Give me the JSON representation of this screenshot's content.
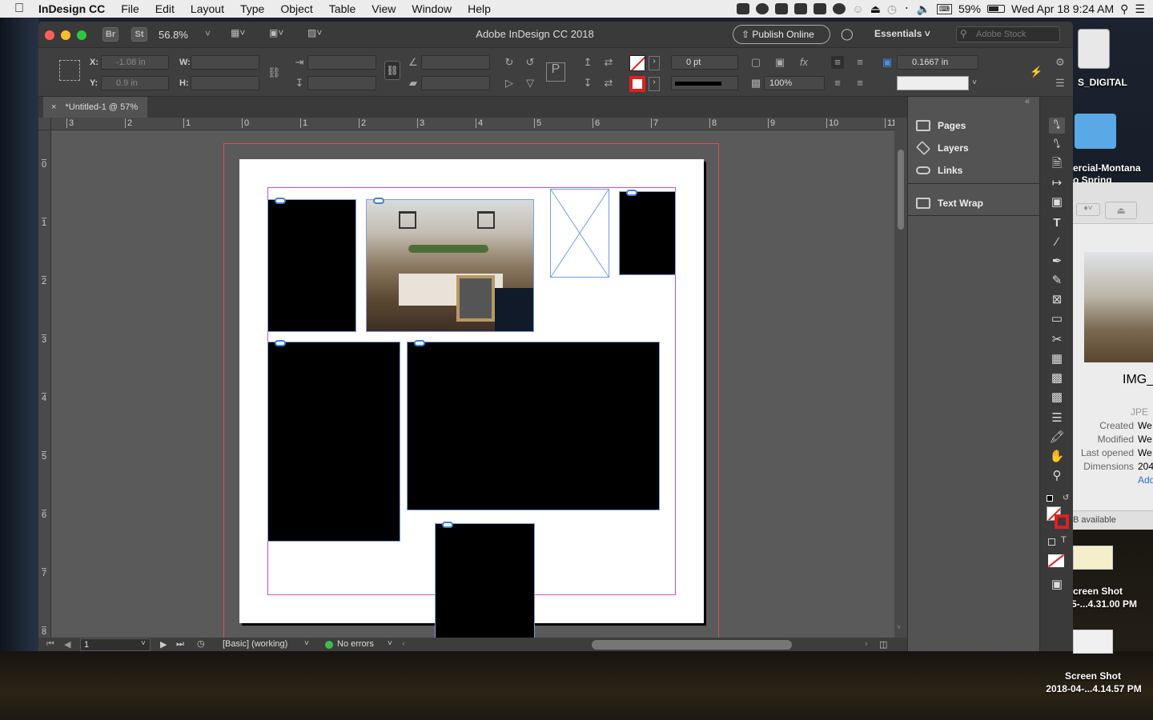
{
  "menubar": {
    "app": "InDesign CC",
    "items": [
      "File",
      "Edit",
      "Layout",
      "Type",
      "Object",
      "Table",
      "View",
      "Window",
      "Help"
    ],
    "battery": "59%",
    "clock": "Wed Apr 18  9:24 AM"
  },
  "window": {
    "title": "Adobe InDesign CC 2018",
    "zoom": "56.8%",
    "br": "Br",
    "st": "St",
    "publish": "Publish Online",
    "workspace": "Essentials",
    "stock_placeholder": "Adobe Stock"
  },
  "control": {
    "x_label": "X:",
    "x_value": "-1.08 in",
    "y_label": "Y:",
    "y_value": "0.9 in",
    "w_label": "W:",
    "h_label": "H:",
    "stroke_weight": "0 pt",
    "opacity": "100%",
    "offset": "0.1667 in"
  },
  "document": {
    "tab": "*Untitled-1 @ 57%",
    "hruler": [
      "3",
      "2",
      "1",
      "0",
      "1",
      "2",
      "3",
      "4",
      "5",
      "6",
      "7",
      "8",
      "9",
      "10",
      "11"
    ],
    "vruler": [
      "0",
      "1",
      "2",
      "3",
      "4",
      "5",
      "6",
      "7",
      "8"
    ]
  },
  "status": {
    "page": "1",
    "style": "[Basic] (working)",
    "errors": "No errors"
  },
  "panels": {
    "pages": "Pages",
    "layers": "Layers",
    "links": "Links",
    "textwrap": "Text Wrap"
  },
  "desktop": {
    "folder1": "S_DIGITAL",
    "folder2": "ercial-Montana",
    "folder2b": "o Spring",
    "shot1a": "creen Shot",
    "shot1b": "5-...4.31.00 PM",
    "shot2a": "Screen Shot",
    "shot2b": "2018-04-...4.14.57 PM"
  },
  "finder": {
    "filename": "IMG_",
    "kind": "JPE",
    "created_label": "Created",
    "created_value": "We",
    "modified_label": "Modified",
    "modified_value": "We",
    "opened_label": "Last opened",
    "opened_value": "We",
    "dims_label": "Dimensions",
    "dims_value": "204",
    "add": "Add",
    "available": "B available"
  },
  "colors": {
    "accent": "#3f7fdc",
    "frame_edge": "#7b9fe0",
    "margin": "#d04fc2",
    "bleed": "#e05050",
    "status_ok": "#3dbe4e"
  }
}
